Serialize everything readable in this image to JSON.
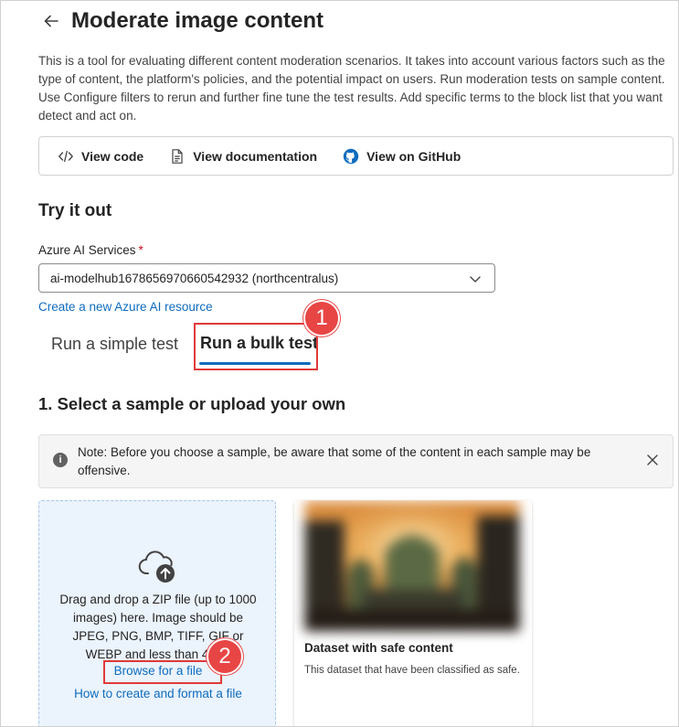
{
  "page": {
    "title": "Moderate image content",
    "description": "This is a tool for evaluating different content moderation scenarios. It takes into account various factors such as the type of content, the platform's policies, and the potential impact on users. Run moderation tests on sample content. Use Configure filters to rerun and further fine tune the test results. Add specific terms to the block list that you want detect and act on."
  },
  "links": {
    "view_code": "View code",
    "view_documentation": "View documentation",
    "view_github": "View on GitHub"
  },
  "try_it_out": {
    "title": "Try it out",
    "services_label": "Azure AI Services",
    "required_mark": "*",
    "selected_service": "ai-modelhub1678656970660542932 (northcentralus)",
    "create_link": "Create a new Azure AI resource"
  },
  "tabs": {
    "simple": "Run a simple test",
    "bulk": "Run a bulk test",
    "active": "bulk"
  },
  "callouts": {
    "one": "1",
    "two": "2"
  },
  "step1": {
    "title": "1. Select a sample or upload your own",
    "note": "Note: Before you choose a sample, be aware that some of the content in each sample may be offensive."
  },
  "upload": {
    "instructions": "Drag and drop a ZIP file (up to 1000 images) here. Image should be JPEG, PNG, BMP, TIFF, GIF or WEBP and less than 4MB.",
    "browse": "Browse for a file",
    "howto": "How to create and format a file"
  },
  "dataset_card": {
    "title": "Dataset with safe content",
    "description": "This dataset that have been classified as safe."
  },
  "colors": {
    "accent": "#0f6cbd",
    "callout": "#e84545",
    "upload_bg": "#ebf3fc"
  },
  "icons": {
    "back": "arrow-left-icon",
    "code": "code-icon",
    "document": "document-icon",
    "github": "github-icon",
    "chevron": "chevron-down-icon",
    "info": "info-icon",
    "close": "close-icon",
    "upload": "cloud-upload-icon"
  }
}
